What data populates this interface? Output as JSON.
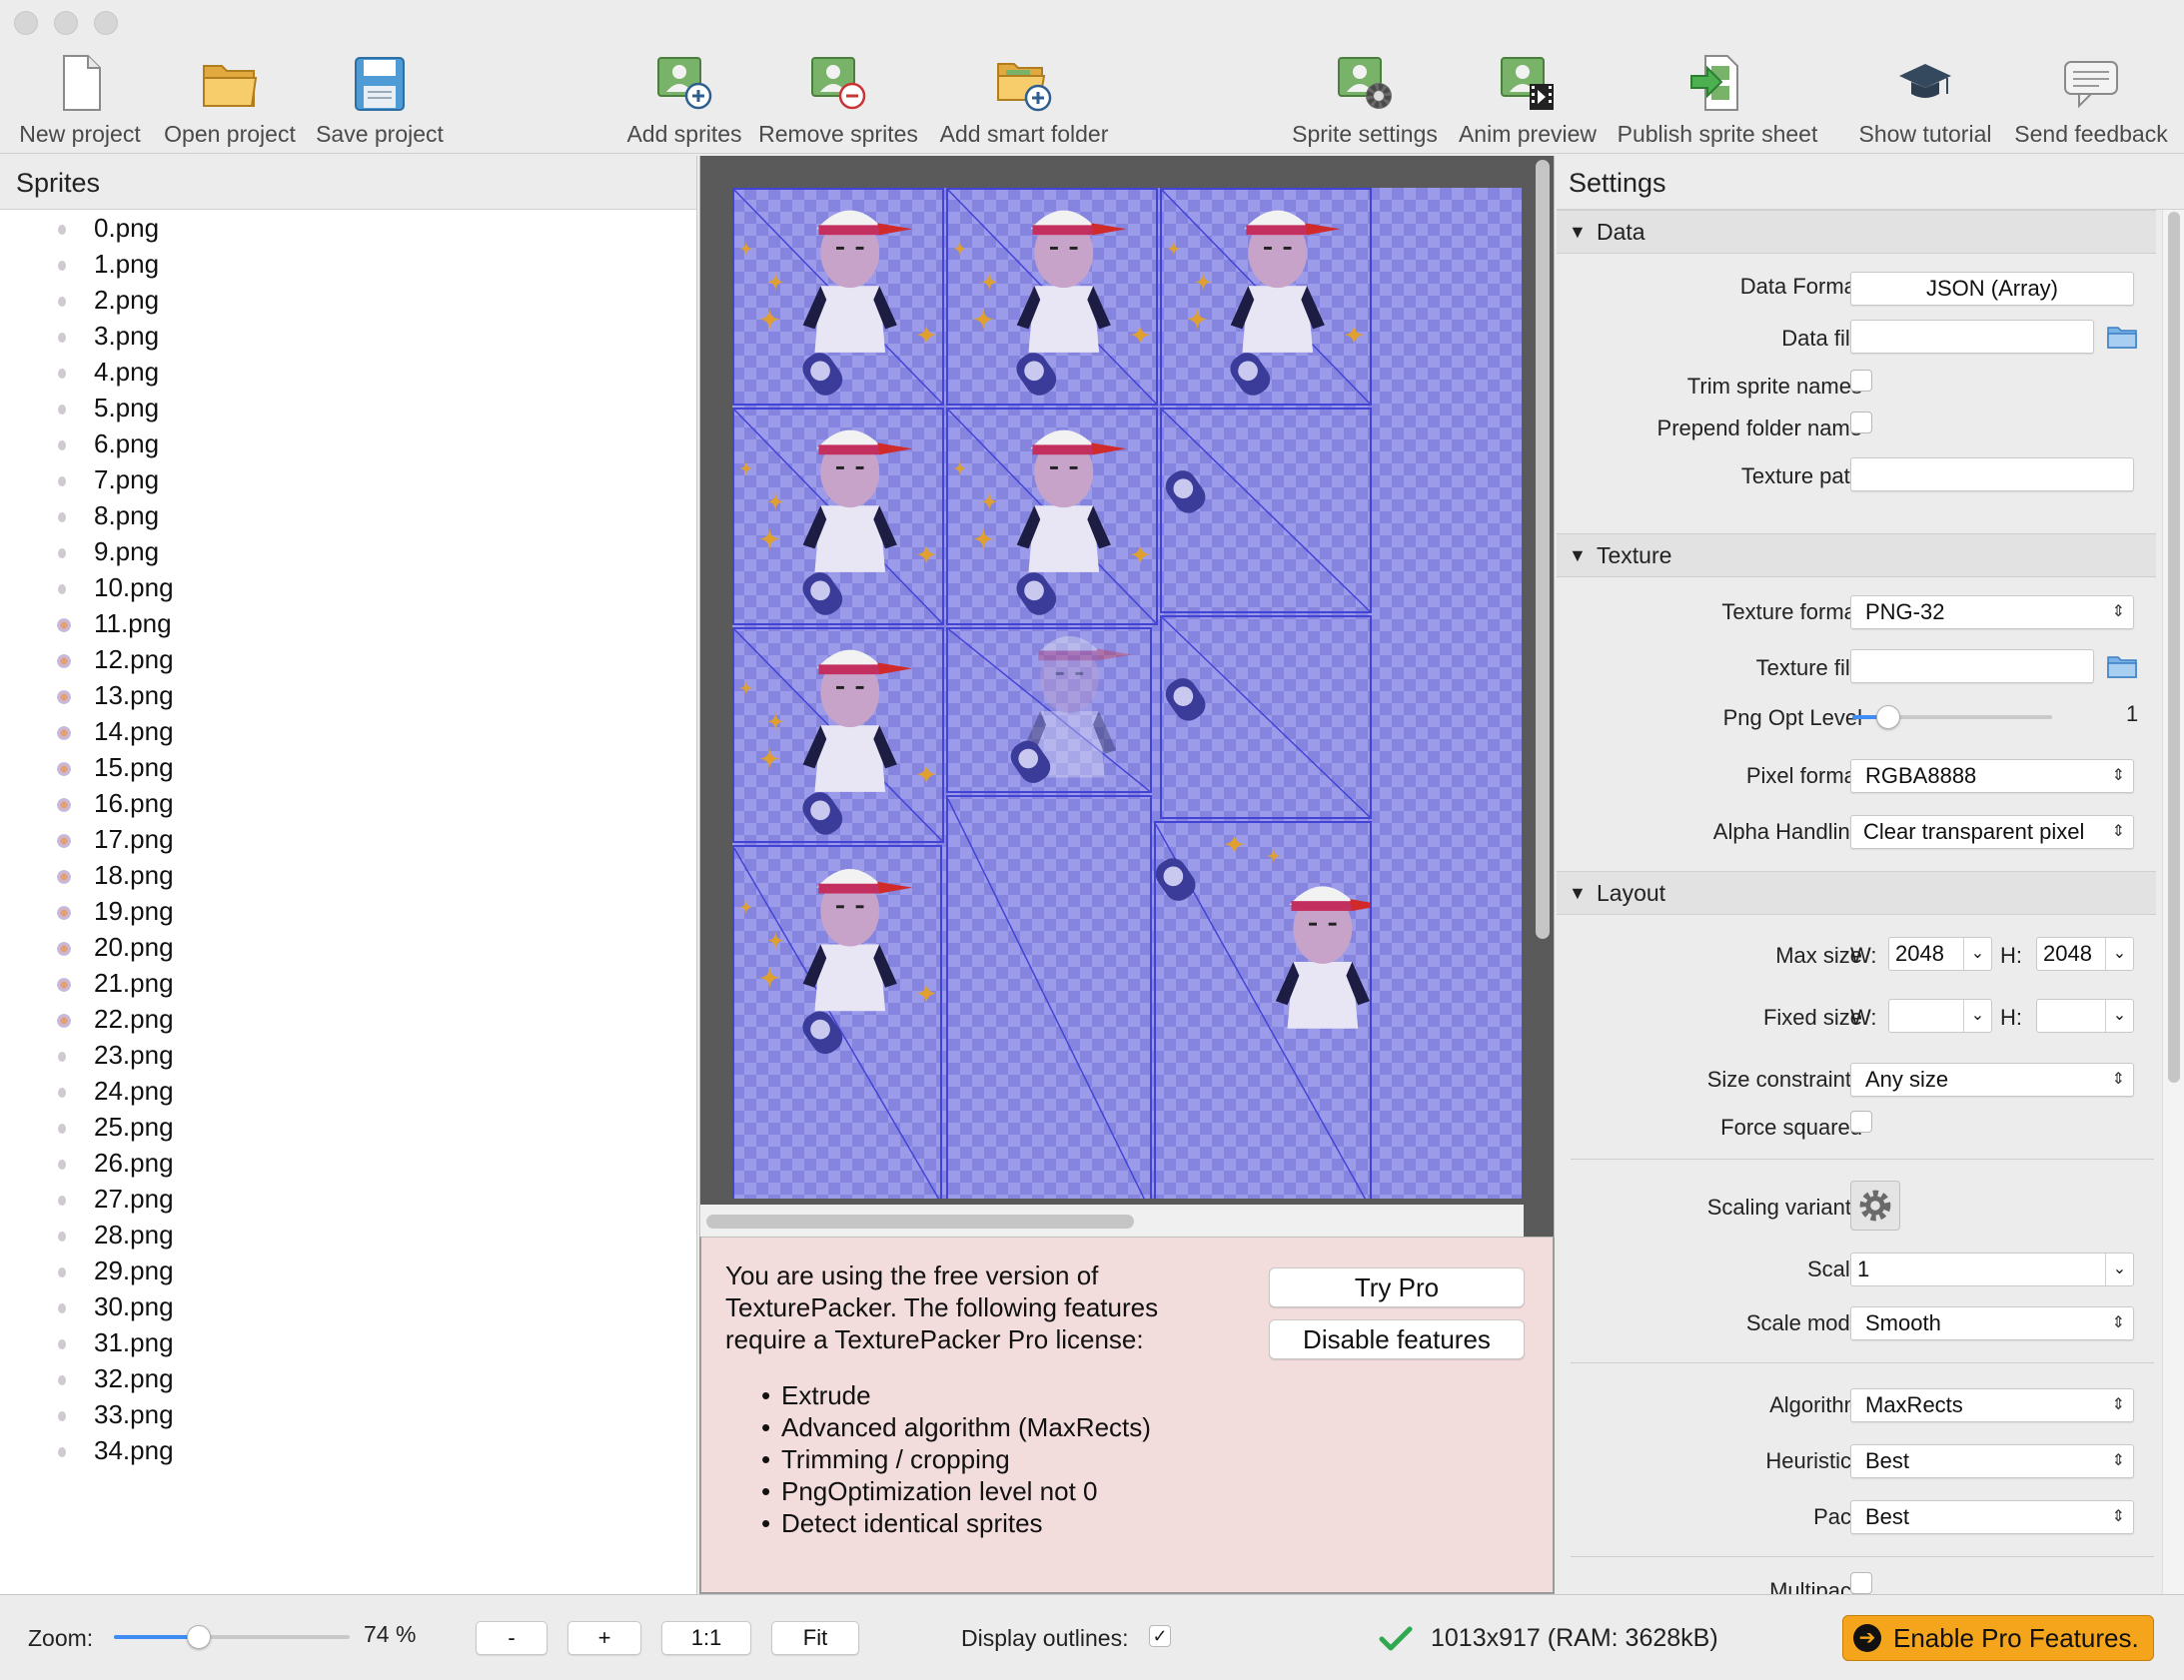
{
  "toolbar": {
    "new_project": "New project",
    "open_project": "Open project",
    "save_project": "Save project",
    "add_sprites": "Add sprites",
    "remove_sprites": "Remove sprites",
    "add_smart_folder": "Add smart folder",
    "sprite_settings": "Sprite settings",
    "anim_preview": "Anim preview",
    "publish_sprite_sheet": "Publish sprite sheet",
    "show_tutorial": "Show tutorial",
    "send_feedback": "Send feedback"
  },
  "sprites_panel": {
    "title": "Sprites",
    "items": [
      "0.png",
      "1.png",
      "2.png",
      "3.png",
      "4.png",
      "5.png",
      "6.png",
      "7.png",
      "8.png",
      "9.png",
      "10.png",
      "11.png",
      "12.png",
      "13.png",
      "14.png",
      "15.png",
      "16.png",
      "17.png",
      "18.png",
      "19.png",
      "20.png",
      "21.png",
      "22.png",
      "23.png",
      "24.png",
      "25.png",
      "26.png",
      "27.png",
      "28.png",
      "29.png",
      "30.png",
      "31.png",
      "32.png",
      "33.png",
      "34.png"
    ]
  },
  "notice": {
    "text": "You are using the free version of TexturePacker. The following features require a TexturePacker Pro license:",
    "features": [
      "Extrude",
      "Advanced algorithm (MaxRects)",
      "Trimming / cropping",
      "PngOptimization level not 0",
      "Detect identical sprites"
    ],
    "try_pro": "Try Pro",
    "disable_features": "Disable features"
  },
  "settings": {
    "title": "Settings",
    "data_section": {
      "title": "Data",
      "data_format_label": "Data Format",
      "data_format_value": "JSON (Array)",
      "data_file_label": "Data file",
      "data_file_value": "",
      "trim_sprite_names_label": "Trim sprite names",
      "trim_sprite_names": false,
      "prepend_folder_name_label": "Prepend folder name",
      "prepend_folder_name": false,
      "texture_path_label": "Texture path",
      "texture_path_value": ""
    },
    "texture_section": {
      "title": "Texture",
      "texture_format_label": "Texture format",
      "texture_format_value": "PNG-32",
      "texture_file_label": "Texture file",
      "texture_file_value": "",
      "png_opt_level_label": "Png Opt Level",
      "png_opt_level_value": "1",
      "pixel_format_label": "Pixel format",
      "pixel_format_value": "RGBA8888",
      "alpha_handling_label": "Alpha Handling",
      "alpha_handling_value": "Clear transparent pixel"
    },
    "layout_section": {
      "title": "Layout",
      "max_size_label": "Max size",
      "w_label": "W:",
      "h_label": "H:",
      "max_w": "2048",
      "max_h": "2048",
      "fixed_size_label": "Fixed size",
      "fixed_w": "",
      "fixed_h": "",
      "size_constraints_label": "Size constraints",
      "size_constraints_value": "Any size",
      "force_squared_label": "Force squared",
      "force_squared": false,
      "scaling_variants_label": "Scaling variants",
      "scale_label": "Scale",
      "scale_value": "1",
      "scale_mode_label": "Scale mode",
      "scale_mode_value": "Smooth",
      "algorithm_label": "Algorithm",
      "algorithm_value": "MaxRects",
      "heuristics_label": "Heuristics",
      "heuristics_value": "Best",
      "pack_label": "Pack",
      "pack_value": "Best",
      "multipack_label": "Multipack"
    }
  },
  "statusbar": {
    "zoom_label": "Zoom:",
    "zoom_value": "74 %",
    "zoom_level": 0.36,
    "zoom_out": "-",
    "zoom_in": "+",
    "zoom_1to1": "1:1",
    "zoom_fit": "Fit",
    "display_outlines_label": "Display outlines:",
    "display_outlines": true,
    "sheet_info": "1013x917 (RAM: 3628kB)",
    "enable_pro": "Enable Pro Features."
  },
  "colors": {
    "accent": "#3d8df5",
    "pro_button": "#f5a51c",
    "notice_bg": "#f2dcdc",
    "atlas_outline": "#4343d6",
    "success": "#2fa84f"
  },
  "icons": {
    "new_project": "blank-document-icon",
    "open_project": "open-folder-icon",
    "save_project": "floppy-disk-icon",
    "add_sprites": "add-image-icon",
    "remove_sprites": "remove-image-icon",
    "add_smart_folder": "smart-folder-add-icon",
    "sprite_settings": "image-gear-icon",
    "anim_preview": "image-film-icon",
    "publish_sprite_sheet": "publish-arrow-icon",
    "show_tutorial": "graduation-cap-icon",
    "send_feedback": "speech-bubble-icon"
  }
}
